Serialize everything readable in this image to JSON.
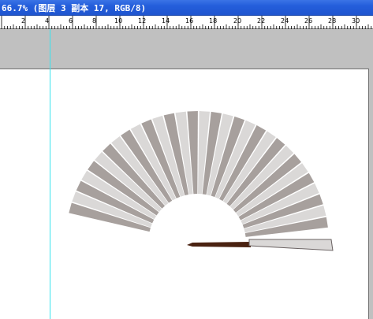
{
  "window": {
    "title": "66.7% (图层 3 副本 17, RGB/8)"
  },
  "ruler": {
    "labels": [
      "2",
      "4",
      "6",
      "8",
      "10",
      "12",
      "14",
      "16",
      "18",
      "20",
      "22",
      "24",
      "26",
      "28",
      "30"
    ]
  },
  "colors": {
    "title_bar": "#245edb",
    "pasteboard": "#c0c0c0",
    "guide": "#38e4ee",
    "rib_dark": "#a7a09d",
    "rib_light": "#dad8d7",
    "fan_handle": "#4a2211"
  },
  "artwork": {
    "icon": "folding-fan"
  }
}
